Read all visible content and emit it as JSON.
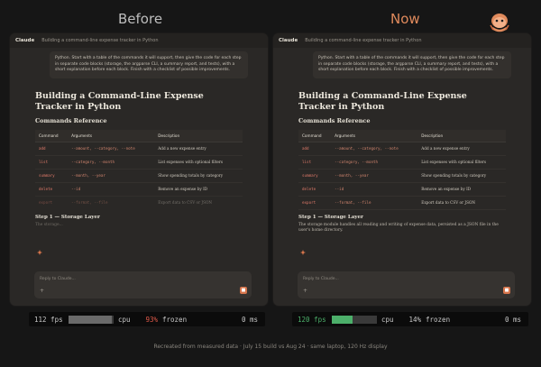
{
  "titles": {
    "before": "Before",
    "now": "Now"
  },
  "colors": {
    "accent": "#e08a5c",
    "bad": "#e05a4a",
    "good": "#4caf6a"
  },
  "panel": {
    "app_name": "Claude",
    "crumb": "Building a command-line expense tracker in Python",
    "message": "Python. Start with a table of the commands it will support, then give the code for each step in separate code blocks (storage, the argparse CLI, a summary report, and tests), with a short explanation before each block. Finish with a checklist of possible improvements.",
    "doc_title": "Building a Command-Line Expense Tracker in Python",
    "section": "Commands Reference",
    "table_headers": [
      "Command",
      "Arguments",
      "Description"
    ],
    "rows": [
      {
        "cmd": "add",
        "args": "--amount, --category, --note",
        "desc": "Add a new expense entry"
      },
      {
        "cmd": "list",
        "args": "--category, --month",
        "desc": "List expenses with optional filters"
      },
      {
        "cmd": "summary",
        "args": "--month, --year",
        "desc": "Show spending totals by category"
      },
      {
        "cmd": "delete",
        "args": "--id",
        "desc": "Remove an expense by ID"
      },
      {
        "cmd": "export",
        "args": "--format, --file",
        "desc": "Export data to CSV or JSON"
      }
    ],
    "step": "Step 1 — Storage Layer",
    "step_text_before": "The storage...",
    "step_text_now": "The storage module handles all reading and writing of expense data, persisted as a JSON file in the user's home directory.",
    "composer_placeholder": "Reply to Claude...",
    "plus": "+"
  },
  "perf": {
    "before": {
      "fps": "112 fps",
      "fps_fill": 0.95,
      "cpu": "cpu",
      "cpu_pct": "93%",
      "frozen": "frozen",
      "ms": "0 ms"
    },
    "now": {
      "fps": "120 fps",
      "fps_fill": 0.45,
      "cpu": "cpu",
      "cpu_pct": "14%",
      "frozen": "frozen",
      "ms": "0 ms"
    }
  },
  "caption": "Recreated from measured data · July 15 build vs Aug 24 · same laptop, 120 Hz display"
}
